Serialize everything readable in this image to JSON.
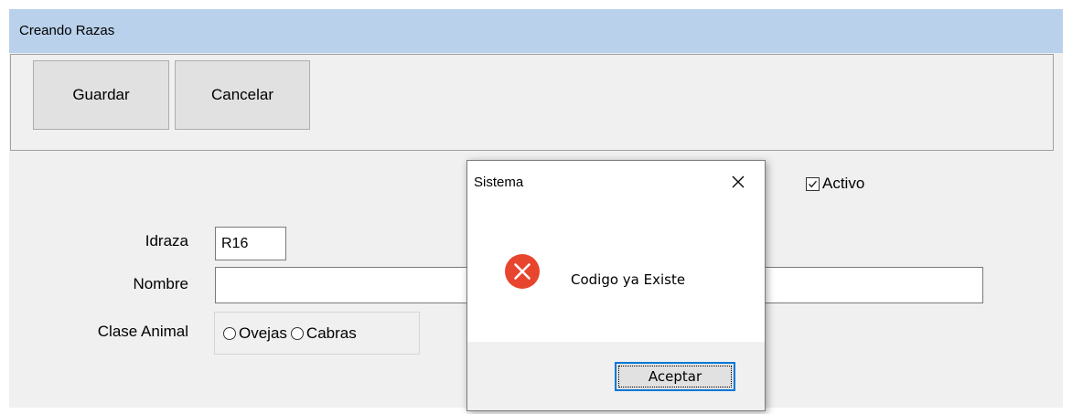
{
  "window": {
    "title": "Creando Razas"
  },
  "toolbar": {
    "save_label": "Guardar",
    "cancel_label": "Cancelar"
  },
  "form": {
    "active_label": "Activo",
    "active_checked": true,
    "idraza_label": "Idraza",
    "idraza_value": "R16",
    "nombre_label": "Nombre",
    "nombre_value": "",
    "clase_label": "Clase Animal",
    "clase_options": [
      "Ovejas",
      "Cabras"
    ]
  },
  "dialog": {
    "title": "Sistema",
    "message": "Codigo ya Existe",
    "ok_label": "Aceptar",
    "icon": "error-icon"
  },
  "colors": {
    "titlebar": "#b9d1ea",
    "error": "#e8452e",
    "focus": "#0078d7"
  }
}
